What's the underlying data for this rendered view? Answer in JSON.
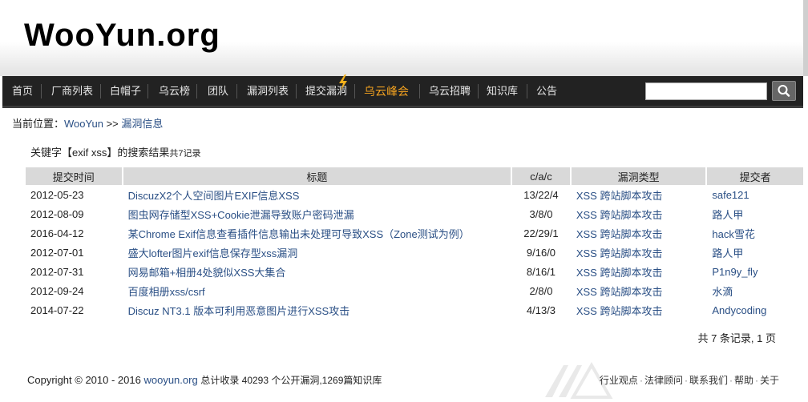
{
  "header": {
    "logo_text": "WooYun.org"
  },
  "nav": {
    "items": [
      {
        "label": "首页"
      },
      {
        "label": "厂商列表"
      },
      {
        "label": "白帽子"
      },
      {
        "label": "乌云榜"
      },
      {
        "label": "团队"
      },
      {
        "label": "漏洞列表"
      },
      {
        "label": "提交漏洞"
      },
      {
        "label": "乌云峰会"
      },
      {
        "label": "乌云招聘"
      },
      {
        "label": "知识库"
      },
      {
        "label": "公告"
      }
    ],
    "search": {
      "value": "",
      "placeholder": ""
    }
  },
  "breadcrumb": {
    "prefix": "当前位置：",
    "home": "WooYun",
    "sep": ">>",
    "current": "漏洞信息"
  },
  "results": {
    "heading": "关键字【exif xss】的搜索结果",
    "count_text": "共7记录",
    "columns": [
      "提交时间",
      "标题",
      "c/a/c",
      "漏洞类型",
      "提交者"
    ],
    "rows": [
      {
        "date": "2012-05-23",
        "title": "DiscuzX2个人空间图片EXIF信息XSS",
        "cac": "13/22/4",
        "type": "XSS 跨站脚本攻击",
        "author": "safe121"
      },
      {
        "date": "2012-08-09",
        "title": "图虫网存储型XSS+Cookie泄漏导致账户密码泄漏",
        "cac": "3/8/0",
        "type": "XSS 跨站脚本攻击",
        "author": "路人甲"
      },
      {
        "date": "2016-04-12",
        "title": "某Chrome Exif信息查看插件信息输出未处理可导致XSS（Zone测试为例）",
        "cac": "22/29/1",
        "type": "XSS 跨站脚本攻击",
        "author": "hack雪花"
      },
      {
        "date": "2012-07-01",
        "title": "盛大lofter图片exif信息保存型xss漏洞",
        "cac": "9/16/0",
        "type": "XSS 跨站脚本攻击",
        "author": "路人甲"
      },
      {
        "date": "2012-07-31",
        "title": "网易邮箱+相册4处貌似XSS大集合",
        "cac": "8/16/1",
        "type": "XSS 跨站脚本攻击",
        "author": "P1n9y_fly"
      },
      {
        "date": "2012-09-24",
        "title": "百度相册xss/csrf",
        "cac": "2/8/0",
        "type": "XSS 跨站脚本攻击",
        "author": "水滴"
      },
      {
        "date": "2014-07-22",
        "title": "Discuz NT3.1 版本可利用恶意图片进行XSS攻击",
        "cac": "4/13/3",
        "type": "XSS 跨站脚本攻击",
        "author": "Andycoding"
      }
    ]
  },
  "pager": {
    "text": "共 7 条记录, 1 页"
  },
  "footer": {
    "copyright": "Copyright © 2010 - 2016",
    "site_link": "wooyun.org",
    "stats_prefix": "总计收录 40293 个公开漏洞,1269篇知识库",
    "links": [
      "行业观点",
      "法律顾问",
      "联系我们",
      "帮助",
      "关于"
    ]
  },
  "colors": {
    "nav_bg": "#222222",
    "link": "#2a4f85",
    "hot": "#f0a020",
    "table_header_bg": "#d9d9d9"
  },
  "icons": {
    "bolt": "lightning-bolt-icon",
    "search": "magnifier-icon"
  }
}
